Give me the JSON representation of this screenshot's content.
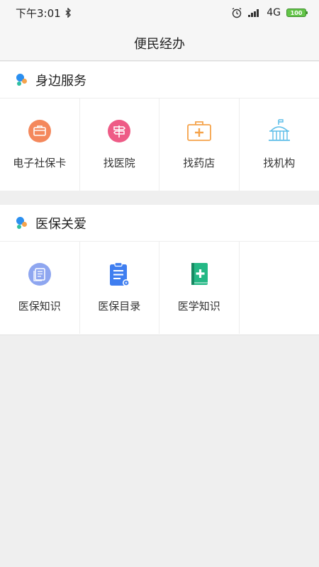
{
  "status_bar": {
    "time": "下午3:01",
    "network": "4G",
    "battery": "100"
  },
  "header": {
    "title": "便民经办"
  },
  "sections": [
    {
      "title": "身边服务",
      "items": [
        {
          "label": "电子社保卡",
          "icon": "social-security-card-icon",
          "color": "#f4885c"
        },
        {
          "label": "找医院",
          "icon": "hospital-signpost-icon",
          "color": "#ee5b86"
        },
        {
          "label": "找药店",
          "icon": "pharmacy-kit-icon",
          "color": "#f5a34b"
        },
        {
          "label": "找机构",
          "icon": "institution-building-icon",
          "color": "#5bbde8"
        }
      ]
    },
    {
      "title": "医保关爱",
      "items": [
        {
          "label": "医保知识",
          "icon": "insurance-knowledge-icon",
          "color": "#8ea6f0"
        },
        {
          "label": "医保目录",
          "icon": "insurance-catalog-icon",
          "color": "#3f7ef0"
        },
        {
          "label": "医学知识",
          "icon": "medical-book-icon",
          "color": "#24b885"
        }
      ]
    }
  ]
}
